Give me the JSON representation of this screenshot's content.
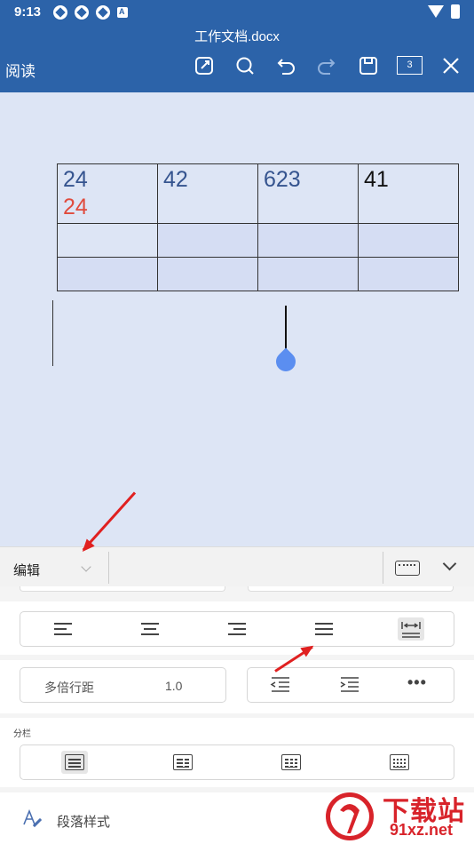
{
  "status_bar": {
    "time": "9:13"
  },
  "title_bar": {
    "document_title": "工作文档.docx",
    "mode_label": "阅读",
    "page_count": "3",
    "icons": [
      "edit-icon",
      "search-icon",
      "undo-icon",
      "redo-icon",
      "save-icon",
      "page-count-icon",
      "close-icon"
    ]
  },
  "document": {
    "table": [
      [
        {
          "lines": [
            "24",
            "24"
          ],
          "colors": [
            "#35548f",
            "#e04b3d"
          ]
        },
        {
          "lines": [
            "42"
          ],
          "colors": [
            "#35548f"
          ]
        },
        {
          "lines": [
            "623"
          ],
          "colors": [
            "#35548f"
          ]
        },
        {
          "lines": [
            "41"
          ],
          "colors": [
            "#111111"
          ]
        }
      ],
      [
        {
          "lines": []
        },
        {
          "lines": []
        },
        {
          "lines": []
        },
        {
          "lines": []
        }
      ],
      [
        {
          "lines": []
        },
        {
          "lines": []
        },
        {
          "lines": []
        },
        {
          "lines": []
        }
      ]
    ]
  },
  "edit_bar": {
    "mode_label": "编辑"
  },
  "panel": {
    "alignment_buttons": [
      "align-left-icon",
      "align-center-icon",
      "align-right-icon",
      "justify-icon",
      "distributed-icon"
    ],
    "line_spacing": {
      "label": "多倍行距",
      "value": "1.0"
    },
    "indent_buttons": [
      "decrease-indent-icon",
      "increase-indent-icon",
      "more-icon"
    ],
    "columns": {
      "title": "分栏",
      "options": [
        "one-column-icon",
        "two-columns-icon",
        "three-columns-icon",
        "four-columns-icon"
      ]
    },
    "paragraph_style_label": "段落样式"
  },
  "watermark": {
    "text_main": "下载站",
    "text_sub": "91xz.net"
  },
  "colors": {
    "header_bg": "#2c63a9",
    "doc_bg": "#dde5f5",
    "annotation_arrow": "#e02020"
  }
}
